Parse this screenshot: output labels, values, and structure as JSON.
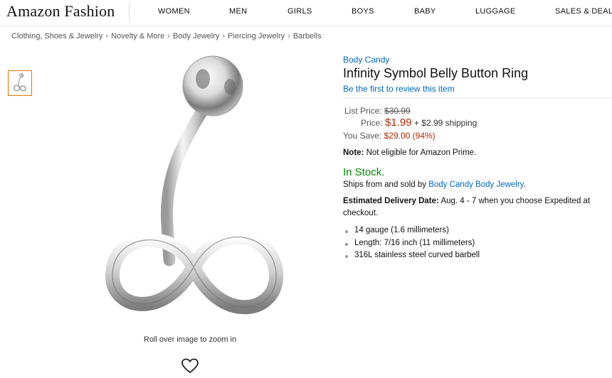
{
  "header": {
    "logo": "Amazon Fashion",
    "nav": [
      "WOMEN",
      "MEN",
      "GIRLS",
      "BOYS",
      "BABY",
      "LUGGAGE",
      "SALES & DEALS"
    ]
  },
  "breadcrumb": [
    "Clothing, Shoes & Jewelry",
    "Novelty & More",
    "Body Jewelry",
    "Piercing Jewelry",
    "Barbells"
  ],
  "breadcrumb_separator": "›",
  "gallery": {
    "zoom_hint": "Roll over image to zoom in",
    "favorite_icon": "heart-icon"
  },
  "product": {
    "brand": "Body Candy",
    "title": "Infinity Symbol Belly Button Ring",
    "review_link": "Be the first to review this item",
    "pricing": {
      "list_price_label": "List Price:",
      "list_price": "$30.99",
      "price_label": "Price:",
      "price": "$1.99",
      "shipping": "+ $2.99 shipping",
      "save_label": "You Save:",
      "save_amount": "$29.00 (94%)"
    },
    "note_label": "Note:",
    "note_text": "Not eligible for Amazon Prime.",
    "stock": "In Stock.",
    "ships_prefix": "Ships from and sold by",
    "seller": "Body Candy Body Jewelry",
    "ships_suffix": ".",
    "delivery_label": "Estimated Delivery Date:",
    "delivery_text": "Aug. 4 - 7 when you choose Expedited at checkout.",
    "features": [
      "14 gauge (1.6 millimeters)",
      "Length: 7/16 inch (11 millimeters)",
      "316L stainless steel curved barbell"
    ]
  },
  "colors": {
    "link": "#0066c0",
    "price": "#b12704",
    "in_stock": "#008a00",
    "thumb_selected_border": "#e77600"
  }
}
